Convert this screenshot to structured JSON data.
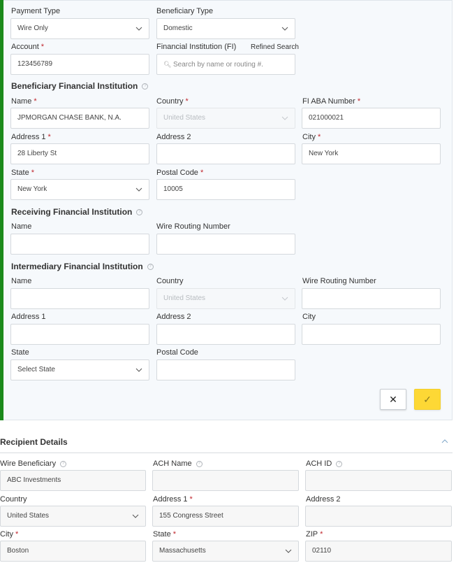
{
  "payment_form": {
    "payment_type": {
      "label": "Payment Type",
      "value": "Wire Only"
    },
    "beneficiary_type": {
      "label": "Beneficiary Type",
      "value": "Domestic"
    },
    "account": {
      "label": "Account",
      "required": "*",
      "value": "123456789"
    },
    "financial_institution": {
      "label": "Financial Institution (FI)",
      "refined_search": "Refined Search",
      "placeholder": "Search by name or routing #."
    }
  },
  "beneficiary_fi": {
    "title": "Beneficiary Financial Institution",
    "help": "?",
    "name": {
      "label": "Name",
      "required": "*",
      "value": "JPMORGAN CHASE BANK, N.A."
    },
    "country": {
      "label": "Country",
      "required": "*",
      "value": "United States"
    },
    "aba": {
      "label": "FI ABA Number",
      "required": "*",
      "value": "021000021"
    },
    "address1": {
      "label": "Address 1",
      "required": "*",
      "value": "28 Liberty St"
    },
    "address2": {
      "label": "Address 2",
      "value": ""
    },
    "city": {
      "label": "City",
      "required": "*",
      "value": "New York"
    },
    "state": {
      "label": "State",
      "required": "*",
      "value": "New York"
    },
    "postal": {
      "label": "Postal Code",
      "required": "*",
      "value": "10005"
    }
  },
  "receiving_fi": {
    "title": "Receiving Financial Institution",
    "help": "?",
    "name": {
      "label": "Name",
      "value": ""
    },
    "routing": {
      "label": "Wire Routing Number",
      "value": ""
    }
  },
  "intermediary_fi": {
    "title": "Intermediary Financial Institution",
    "help": "?",
    "name": {
      "label": "Name",
      "value": ""
    },
    "country": {
      "label": "Country",
      "value": "United States"
    },
    "routing": {
      "label": "Wire Routing Number",
      "value": ""
    },
    "address1": {
      "label": "Address 1",
      "value": ""
    },
    "address2": {
      "label": "Address 2",
      "value": ""
    },
    "city": {
      "label": "City",
      "value": ""
    },
    "state": {
      "label": "State",
      "value": "Select State"
    },
    "postal": {
      "label": "Postal Code",
      "value": ""
    }
  },
  "actions": {
    "cancel": "✕",
    "confirm": "✓"
  },
  "recipient_details": {
    "title": "Recipient Details",
    "wire_beneficiary": {
      "label": "Wire Beneficiary",
      "value": "ABC Investments"
    },
    "ach_name": {
      "label": "ACH Name",
      "value": ""
    },
    "ach_id": {
      "label": "ACH ID",
      "value": ""
    },
    "country": {
      "label": "Country",
      "value": "United States"
    },
    "address1": {
      "label": "Address 1",
      "required": "*",
      "value": "155 Congress Street"
    },
    "address2": {
      "label": "Address 2",
      "value": ""
    },
    "city": {
      "label": "City",
      "required": "*",
      "value": "Boston"
    },
    "state": {
      "label": "State",
      "required": "*",
      "value": "Massachusetts"
    },
    "zip": {
      "label": "ZIP",
      "required": "*",
      "value": "02110"
    }
  },
  "colors": {
    "accent_green": "#1b8a1b",
    "confirm_yellow": "#fdd835",
    "required_red": "#c0262d"
  }
}
